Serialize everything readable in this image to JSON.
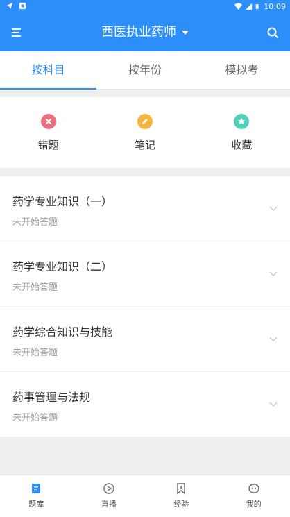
{
  "statusbar": {
    "time": "10:09"
  },
  "appbar": {
    "title": "西医执业药师"
  },
  "tabs": [
    {
      "label": "按科目"
    },
    {
      "label": "按年份"
    },
    {
      "label": "模拟考"
    }
  ],
  "quick": [
    {
      "label": "错题",
      "icon": "close-circle-icon",
      "color": "#ea6f7f"
    },
    {
      "label": "笔记",
      "icon": "pencil-circle-icon",
      "color": "#f3b63c"
    },
    {
      "label": "收藏",
      "icon": "star-circle-icon",
      "color": "#4fd2bb"
    }
  ],
  "subjects": [
    {
      "name": "药学专业知识（一）",
      "status": "未开始答题"
    },
    {
      "name": "药学专业知识（二）",
      "status": "未开始答题"
    },
    {
      "name": "药学综合知识与技能",
      "status": "未开始答题"
    },
    {
      "name": "药事管理与法规",
      "status": "未开始答题"
    }
  ],
  "bottomnav": [
    {
      "label": "题库",
      "icon": "question-bank-icon"
    },
    {
      "label": "直播",
      "icon": "live-play-icon"
    },
    {
      "label": "经验",
      "icon": "bookmark-icon"
    },
    {
      "label": "我的",
      "icon": "profile-face-icon"
    }
  ],
  "colors": {
    "primary": "#2c8ef8"
  }
}
